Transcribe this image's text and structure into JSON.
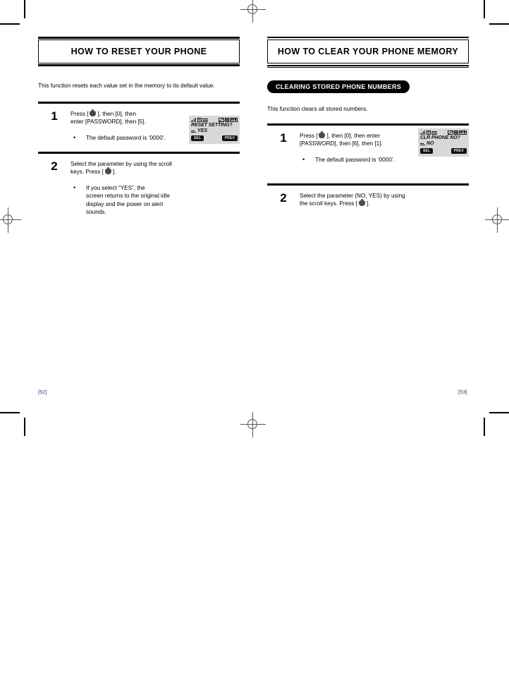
{
  "document": {
    "left_page_number": "[52]",
    "right_page_number": "[53]"
  },
  "left_page": {
    "title": "HOW TO RESET YOUR PHONE",
    "intro": "This function resets each value set in the memory to its default value.",
    "steps": [
      {
        "number": "1",
        "text_before_key": "Press [",
        "text_after_key": "], then [0], then\nenter [PASSWORD], then [5].",
        "bullet": "•",
        "bullet_text": "The default password is ‘0000’.",
        "lcd": {
          "line1": "RESET SETTING?",
          "line2": "YES",
          "softkey_left": "SEL",
          "softkey_right": "PREV",
          "status_icons": [
            "signal-bars-icon",
            "roaming-r-icon",
            "antenna-icon",
            "envelope-icon",
            "box-icon",
            "battery-icon"
          ]
        }
      },
      {
        "number": "2",
        "text_before_key": "Select the parameter by using the scroll\nkeys.  Press [",
        "text_after_key": "].",
        "bullet": "•",
        "bullet_text": "If you select “YES”, the\nscreen returns to the original idle\ndisplay and the power on alert\nsounds."
      }
    ]
  },
  "right_page": {
    "title": "HOW TO CLEAR YOUR PHONE MEMORY",
    "badge": "CLEARING STORED PHONE NUMBERS",
    "intro": "This function clears all stored numbers.",
    "steps": [
      {
        "number": "1",
        "text_before_key": "Press [",
        "text_after_key": "], then [0], then enter\n[PASSWORD], then [6], then [1].",
        "bullet": "•",
        "bullet_text": "The default password is ‘0000’.",
        "lcd": {
          "line1": "CLR PHONE NO?",
          "line2": "NO",
          "softkey_left": "SEL",
          "softkey_right": "PREV",
          "status_icons": [
            "signal-bars-icon",
            "roaming-r-icon",
            "antenna-icon",
            "envelope-icon",
            "box-icon",
            "battery-icon"
          ]
        }
      },
      {
        "number": "2",
        "text_before_key": "Select the parameter (NO, YES) by using\nthe scroll keys.  Press [",
        "text_after_key": "].",
        "bullet": "",
        "bullet_text": ""
      }
    ]
  },
  "print_marks": {
    "registration_label": "registration-target"
  }
}
